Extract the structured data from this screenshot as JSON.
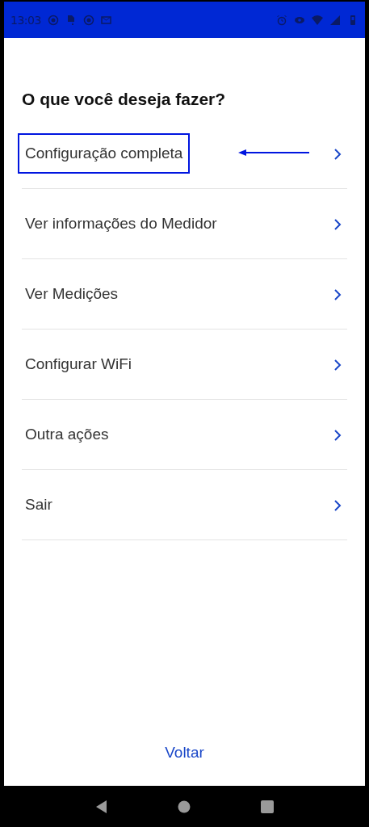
{
  "status_bar": {
    "time": "13:03"
  },
  "title": "O que você deseja fazer?",
  "menu": [
    {
      "label": "Configuração completa",
      "highlighted": true
    },
    {
      "label": "Ver informações do Medidor",
      "highlighted": false
    },
    {
      "label": "Ver Medições",
      "highlighted": false
    },
    {
      "label": "Configurar WiFi",
      "highlighted": false
    },
    {
      "label": "Outra ações",
      "highlighted": false
    },
    {
      "label": "Sair",
      "highlighted": false
    }
  ],
  "back_link": "Voltar"
}
